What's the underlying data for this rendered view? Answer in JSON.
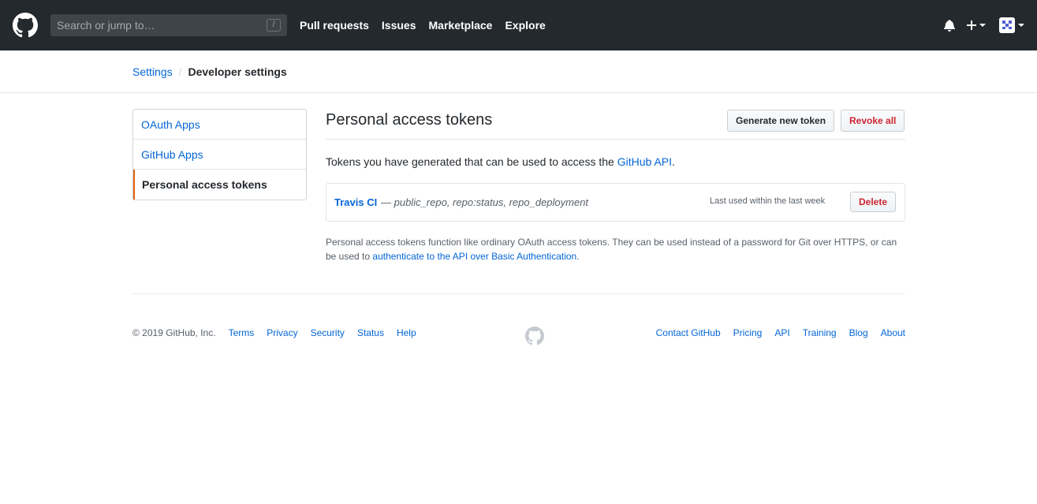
{
  "header": {
    "search_placeholder": "Search or jump to…",
    "slash_key": "/",
    "nav": [
      "Pull requests",
      "Issues",
      "Marketplace",
      "Explore"
    ],
    "plus_label": "+"
  },
  "breadcrumb": {
    "parent": "Settings",
    "current": "Developer settings"
  },
  "sidebar": {
    "items": [
      {
        "label": "OAuth Apps"
      },
      {
        "label": "GitHub Apps"
      },
      {
        "label": "Personal access tokens"
      }
    ]
  },
  "main": {
    "title": "Personal access tokens",
    "generate_label": "Generate new token",
    "revoke_label": "Revoke all",
    "intro_prefix": "Tokens you have generated that can be used to access the ",
    "intro_link": "GitHub API",
    "intro_suffix": ".",
    "token": {
      "name": "Travis CI",
      "scopes": "— public_repo, repo:status, repo_deployment",
      "last_used": "Last used within the last week",
      "delete_label": "Delete"
    },
    "note_prefix": "Personal access tokens function like ordinary OAuth access tokens. They can be used instead of a password for Git over HTTPS, or can be used to ",
    "note_link": "authenticate to the API over Basic Authentication",
    "note_suffix": "."
  },
  "footer": {
    "copyright": "© 2019 GitHub, Inc.",
    "left_links": [
      "Terms",
      "Privacy",
      "Security",
      "Status",
      "Help"
    ],
    "right_links": [
      "Contact GitHub",
      "Pricing",
      "API",
      "Training",
      "Blog",
      "About"
    ]
  }
}
